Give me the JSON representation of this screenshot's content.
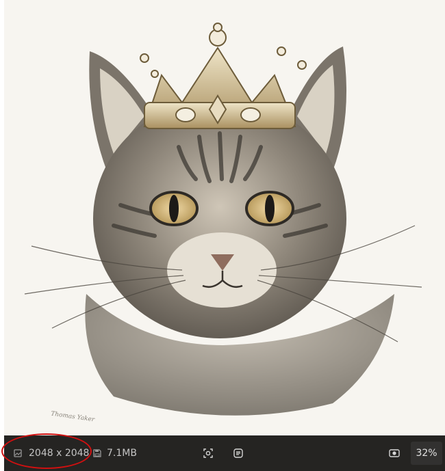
{
  "image": {
    "subject": "Pencil drawing of a tabby cat wearing a jeweled crown",
    "signature_text": "Thomas Yaker"
  },
  "statusbar": {
    "dimensions": "2048 x 2048",
    "file_size": "7.1MB",
    "zoom": "32%",
    "icons": {
      "dimensions": "image-dimensions-icon",
      "file_size": "floppy-disk-icon",
      "fit": "fit-to-window-icon",
      "info": "image-info-icon",
      "actual_size": "actual-size-icon"
    }
  },
  "colors": {
    "statusbar_bg": "#252422",
    "annotation": "#d01010",
    "canvas_bg": "#f7f5f0"
  }
}
